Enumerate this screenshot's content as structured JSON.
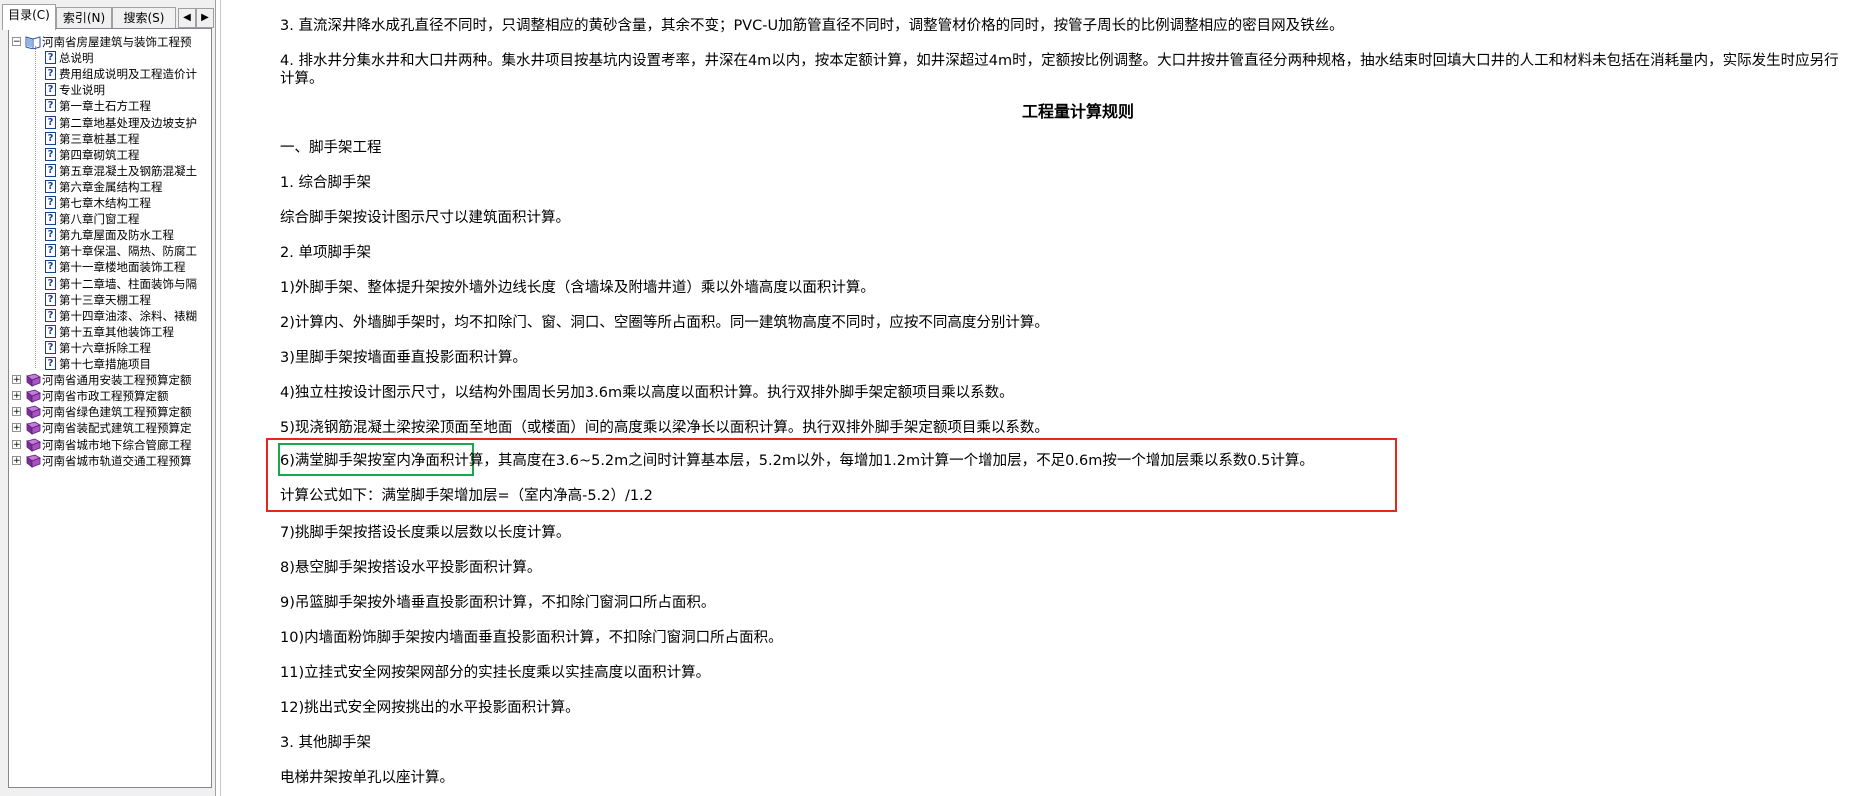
{
  "left_pane": {
    "tabs": [
      "目录(C)",
      "索引(N)",
      "搜索(S)"
    ],
    "arrows": [
      "◀",
      "▶"
    ],
    "tree": {
      "root": {
        "label": "河南省房屋建筑与装饰工程预",
        "expander": "−",
        "icon": "open-book-icon"
      },
      "children": [
        "总说明",
        "费用组成说明及工程造价计",
        "专业说明",
        "第一章土石方工程",
        "第二章地基处理及边坡支护",
        "第三章桩基工程",
        "第四章砌筑工程",
        "第五章混凝土及钢筋混凝土",
        "第六章金属结构工程",
        "第七章木结构工程",
        "第八章门窗工程",
        "第九章屋面及防水工程",
        "第十章保温、隔热、防腐工",
        "第十一章楼地面装饰工程",
        "第十二章墙、柱面装饰与隔",
        "第十三章天棚工程",
        "第十四章油漆、涂料、裱糊",
        "第十五章其他装饰工程",
        "第十六章拆除工程",
        "第十七章措施项目"
      ],
      "siblings": [
        "河南省通用安装工程预算定额",
        "河南省市政工程预算定额",
        "河南省绿色建筑工程预算定额",
        "河南省装配式建筑工程预算定",
        "河南省城市地下综合管廊工程",
        "河南省城市轨道交通工程预算"
      ],
      "sibling_expander": "+",
      "child_icon": "?"
    }
  },
  "content": {
    "p1": "3. 直流深井降水成孔直径不同时，只调整相应的黄砂含量，其余不变；PVC-U加筋管直径不同时，调整管材价格的同时，按管子周长的比例调整相应的密目网及铁丝。",
    "p2": "4. 排水井分集水井和大口井两种。集水井项目按基坑内设置考率，井深在4m以内，按本定额计算，如井深超过4m时，定额按比例调整。大口井按井管直径分两种规格，抽水结束时回填大口井的人工和材料未包括在消耗量内，实际发生时应另行计算。",
    "heading": "工程量计算规则",
    "s1": "一、脚手架工程",
    "s1_1": "1. 综合脚手架",
    "s1_1_text": "综合脚手架按设计图示尺寸以建筑面积计算。",
    "s1_2": "2. 单项脚手架",
    "r1": "1)外脚手架、整体提升架按外墙外边线长度（含墙垛及附墙井道）乘以外墙高度以面积计算。",
    "r2": "2)计算内、外墙脚手架时，均不扣除门、窗、洞口、空圈等所占面积。同一建筑物高度不同时，应按不同高度分别计算。",
    "r3": "3)里脚手架按墙面垂直投影面积计算。",
    "r4": "4)独立柱按设计图示尺寸，以结构外围周长另加3.6m乘以高度以面积计算。执行双排外脚手架定额项目乘以系数。",
    "r5": "5)现浇钢筋混凝土梁按梁顶面至地面（或楼面）间的高度乘以梁净长以面积计算。执行双排外脚手架定额项目乘以系数。",
    "r6": "6)满堂脚手架按室内净面积计算，其高度在3.6~5.2m之间时计算基本层，5.2m以外，每增加1.2m计算一个增加层，不足0.6m按一个增加层乘以系数0.5计算。",
    "r6_formula": "计算公式如下：满堂脚手架增加层=（室内净高-5.2）/1.2",
    "r7": "7)挑脚手架按搭设长度乘以层数以长度计算。",
    "r8": "8)悬空脚手架按搭设水平投影面积计算。",
    "r9": "9)吊篮脚手架按外墙垂直投影面积计算，不扣除门窗洞口所占面积。",
    "r10": "10)内墙面粉饰脚手架按内墙面垂直投影面积计算，不扣除门窗洞口所占面积。",
    "r11": "11)立挂式安全网按架网部分的实挂长度乘以实挂高度以面积计算。",
    "r12": "12)挑出式安全网按挑出的水平投影面积计算。",
    "s1_3": "3. 其他脚手架",
    "s1_3_text": "电梯井架按单孔以座计算。"
  },
  "colors": {
    "highlight_red": "#e8261c",
    "highlight_green": "#1aa64a"
  }
}
